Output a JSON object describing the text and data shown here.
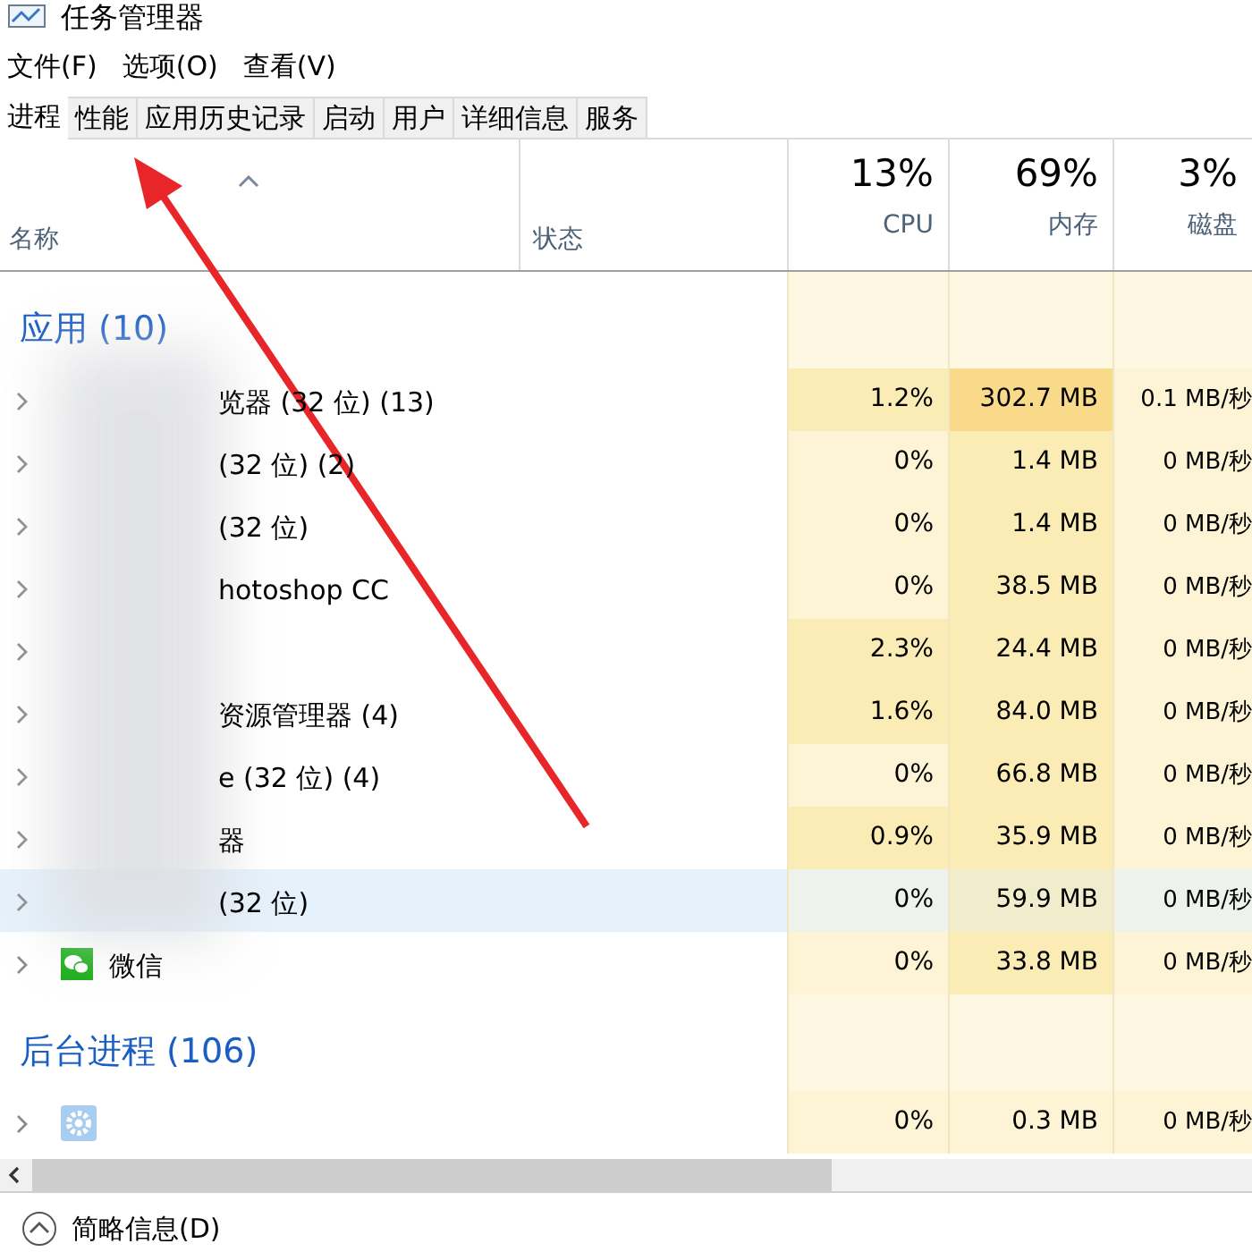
{
  "window": {
    "title": "任务管理器"
  },
  "menu": [
    "文件(F)",
    "选项(O)",
    "查看(V)"
  ],
  "tabs": [
    {
      "label": "进程",
      "selected": true
    },
    {
      "label": "性能",
      "selected": false
    },
    {
      "label": "应用历史记录",
      "selected": false
    },
    {
      "label": "启动",
      "selected": false
    },
    {
      "label": "用户",
      "selected": false
    },
    {
      "label": "详细信息",
      "selected": false
    },
    {
      "label": "服务",
      "selected": false
    }
  ],
  "columns": [
    {
      "label": "名称"
    },
    {
      "label": "状态"
    },
    {
      "percent": "13%",
      "label": "CPU"
    },
    {
      "percent": "69%",
      "label": "内存"
    },
    {
      "percent": "3%",
      "label": "磁盘"
    }
  ],
  "groups": [
    {
      "title": "应用 (10)",
      "rows": [
        {
          "name": "览器 (32 位) (13)",
          "selected": false,
          "cpu": "1.2%",
          "memory": "302.7 MB",
          "disk": "0.1 MB/秒"
        },
        {
          "name": "(32 位) (2)",
          "selected": false,
          "cpu": "0%",
          "memory": "1.4 MB",
          "disk": "0 MB/秒"
        },
        {
          "name": "(32 位)",
          "selected": false,
          "cpu": "0%",
          "memory": "1.4 MB",
          "disk": "0 MB/秒"
        },
        {
          "name": "hotoshop CC",
          "selected": false,
          "cpu": "0%",
          "memory": "38.5 MB",
          "disk": "0 MB/秒"
        },
        {
          "selected": false,
          "cpu": "2.3%",
          "memory": "24.4 MB",
          "disk": "0 MB/秒"
        },
        {
          "name": "资源管理器 (4)",
          "selected": false,
          "cpu": "1.6%",
          "memory": "84.0 MB",
          "disk": "0 MB/秒"
        },
        {
          "name": "e (32 位) (4)",
          "selected": false,
          "cpu": "0%",
          "memory": "66.8 MB",
          "disk": "0 MB/秒"
        },
        {
          "name": "器",
          "selected": false,
          "cpu": "0.9%",
          "memory": "35.9 MB",
          "disk": "0 MB/秒"
        },
        {
          "name": "(32 位)",
          "selected": true,
          "cpu": "0%",
          "memory": "59.9 MB",
          "disk": "0 MB/秒"
        },
        {
          "name": "微信",
          "kind": "wechat",
          "selected": false,
          "cpu": "0%",
          "memory": "33.8 MB",
          "disk": "0 MB/秒"
        }
      ]
    },
    {
      "title": "后台进程 (106)",
      "rows": [
        {
          "kind": "gear",
          "selected": false,
          "cpu": "0%",
          "memory": "0.3 MB",
          "disk": "0 MB/秒"
        }
      ]
    }
  ],
  "footer": {
    "label": "简略信息(D)"
  }
}
